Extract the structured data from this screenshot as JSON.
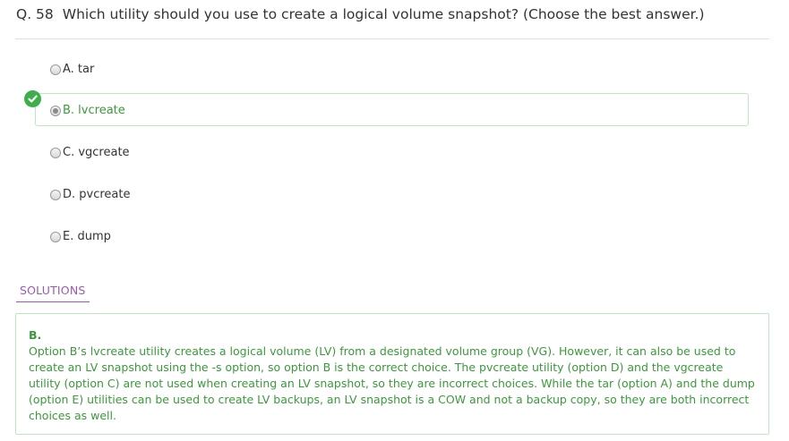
{
  "question": {
    "number": "Q. 58",
    "text": "Which utility should you use to create a logical volume snapshot? (Choose the best answer.)"
  },
  "options": [
    {
      "label": "A. tar"
    },
    {
      "label": "B. lvcreate"
    },
    {
      "label": "C. vgcreate"
    },
    {
      "label": "D. pvcreate"
    },
    {
      "label": "E. dump"
    }
  ],
  "selected_option": "B",
  "solutions": {
    "tab_label": "SOLUTIONS",
    "answer": "B.",
    "explanation": "Option B’s lvcreate utility creates a logical volume (LV) from a designated volume group (VG). However, it can also be used to create an LV snapshot using the -s option, so option B is the correct choice. The pvcreate utility (option D) and the vgcreate utility (option C) are not used when creating an LV snapshot, so they are incorrect choices. While the tar (option A) and the dump (option E) utilities can be used to create LV backups, an LV snapshot is a COW and not a backup copy, so they are both incorrect choices as well."
  },
  "colors": {
    "correct": "#3a9a3a",
    "correct_border": "#bfe6bf",
    "check_badge": "#3cae4a",
    "solutions_tab": "#9b59b6"
  },
  "icons": {
    "correct_marker": "check-circle-icon"
  }
}
